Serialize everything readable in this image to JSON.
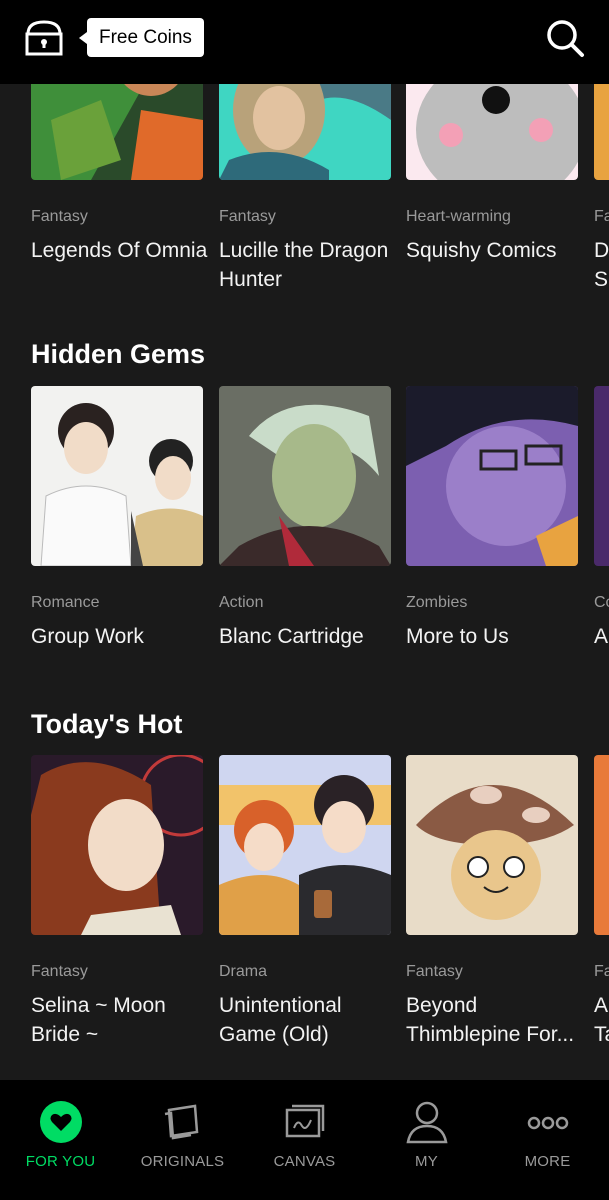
{
  "header": {
    "free_coins_label": "Free Coins",
    "icons": [
      "treasure-chest-icon",
      "search-icon"
    ]
  },
  "top_row": [
    {
      "genre": "Fantasy",
      "title": "Legends Of Omnia"
    },
    {
      "genre": "Fantasy",
      "title": "Lucille the Dragon Hunter"
    },
    {
      "genre": "Heart-warming",
      "title": "Squishy Comics"
    },
    {
      "genre": "Fa",
      "title": "D Su"
    }
  ],
  "hidden_gems": {
    "heading": "Hidden Gems",
    "items": [
      {
        "genre": "Romance",
        "title": "Group Work"
      },
      {
        "genre": "Action",
        "title": "Blanc Cartridge"
      },
      {
        "genre": "Zombies",
        "title": "More to Us"
      },
      {
        "genre": "Co",
        "title": "A"
      }
    ]
  },
  "todays_hot": {
    "heading": "Today's Hot",
    "items": [
      {
        "genre": "Fantasy",
        "title": "Selina ~ Moon Bride ~"
      },
      {
        "genre": "Drama",
        "title": "Unintentional Game (Old)"
      },
      {
        "genre": "Fantasy",
        "title": "Beyond Thimblepine For..."
      },
      {
        "genre": "Fa",
        "title": "A Ta"
      }
    ]
  },
  "nav": {
    "items": [
      {
        "label": "FOR YOU",
        "icon": "heart-icon",
        "active": true
      },
      {
        "label": "ORIGINALS",
        "icon": "originals-pages-icon",
        "active": false
      },
      {
        "label": "CANVAS",
        "icon": "canvas-frame-icon",
        "active": false
      },
      {
        "label": "MY",
        "icon": "person-icon",
        "active": false
      },
      {
        "label": "MORE",
        "icon": "more-dots-icon",
        "active": false
      }
    ],
    "active_color": "#00dc64",
    "inactive_color": "#9a9a9a"
  }
}
